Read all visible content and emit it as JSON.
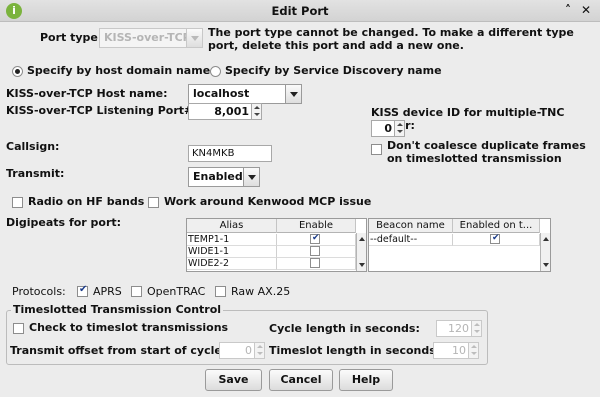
{
  "window": {
    "title": "Edit Port"
  },
  "port_type": {
    "label": "Port type",
    "value": "KISS-over-TCP",
    "note": "The port type cannot be changed. To make a different type port, delete this port and add a new one."
  },
  "specify": {
    "host_option": "Specify by host domain name",
    "sd_option": "Specify by Service Discovery name"
  },
  "host": {
    "label": "KISS-over-TCP Host name:",
    "value": "localhost"
  },
  "listen_port": {
    "label": "KISS-over-TCP Listening Port#:",
    "value": "8,001"
  },
  "kiss_device": {
    "label": "KISS device ID for multiple-TNC server:",
    "value": "0"
  },
  "callsign": {
    "label": "Callsign:",
    "value": "KN4MKB"
  },
  "coalesce": {
    "label": "Don't coalesce duplicate frames on timeslotted transmission"
  },
  "transmit": {
    "label": "Transmit:",
    "value": "Enabled"
  },
  "radio_hf": {
    "label": "Radio on HF bands"
  },
  "kenwood": {
    "label": "Work around Kenwood MCP issue"
  },
  "digipeats": {
    "label": "Digipeats for port:",
    "columns": [
      "Alias",
      "Enable"
    ],
    "rows": [
      {
        "alias": "TEMP1-1",
        "enabled": true
      },
      {
        "alias": "WIDE1-1",
        "enabled": false
      },
      {
        "alias": "WIDE2-2",
        "enabled": false
      }
    ]
  },
  "beacons": {
    "columns": [
      "Beacon name",
      "Enabled on t..."
    ],
    "rows": [
      {
        "name": "--default--",
        "enabled": true
      }
    ]
  },
  "protocols": {
    "label": "Protocols:",
    "aprs": "APRS",
    "opentrac": "OpenTRAC",
    "raw": "Raw AX.25"
  },
  "timeslot": {
    "group_label": "Timeslotted Transmission Control",
    "check_label": "Check to timeslot transmissions",
    "cycle_label": "Cycle length in seconds:",
    "cycle_value": "120",
    "offset_label": "Transmit offset from start of cycle:",
    "offset_value": "0",
    "slot_label": "Timeslot length in seconds:",
    "slot_value": "10"
  },
  "buttons": {
    "save": "Save",
    "cancel": "Cancel",
    "help": "Help"
  }
}
